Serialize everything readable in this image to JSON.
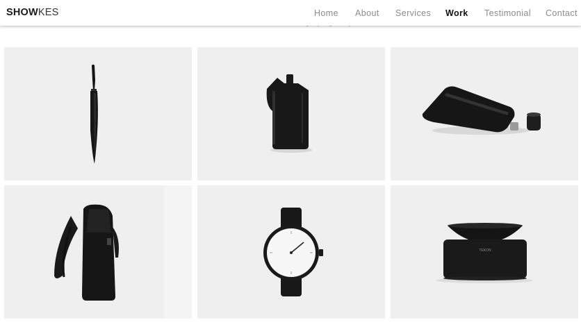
{
  "brand": {
    "bold": "SHOW",
    "light": "KES"
  },
  "nav": {
    "home": "Home",
    "about": "About",
    "services": "Services",
    "work": "Work",
    "testimonial": "Testimonial",
    "contact": "Contact",
    "active": "Work"
  },
  "gallery": {
    "items": [
      {
        "icon": "knife-icon"
      },
      {
        "icon": "flask-bag-icon"
      },
      {
        "icon": "pouch-flask-icon"
      },
      {
        "icon": "backpack-icon"
      },
      {
        "icon": "watch-icon"
      },
      {
        "icon": "speaker-bowl-icon"
      }
    ],
    "speaker_label": "TEKON"
  },
  "colors": {
    "tile_background": "#efefef",
    "product_black": "#141414",
    "nav_muted": "#8b8b8b",
    "nav_active": "#111111"
  }
}
